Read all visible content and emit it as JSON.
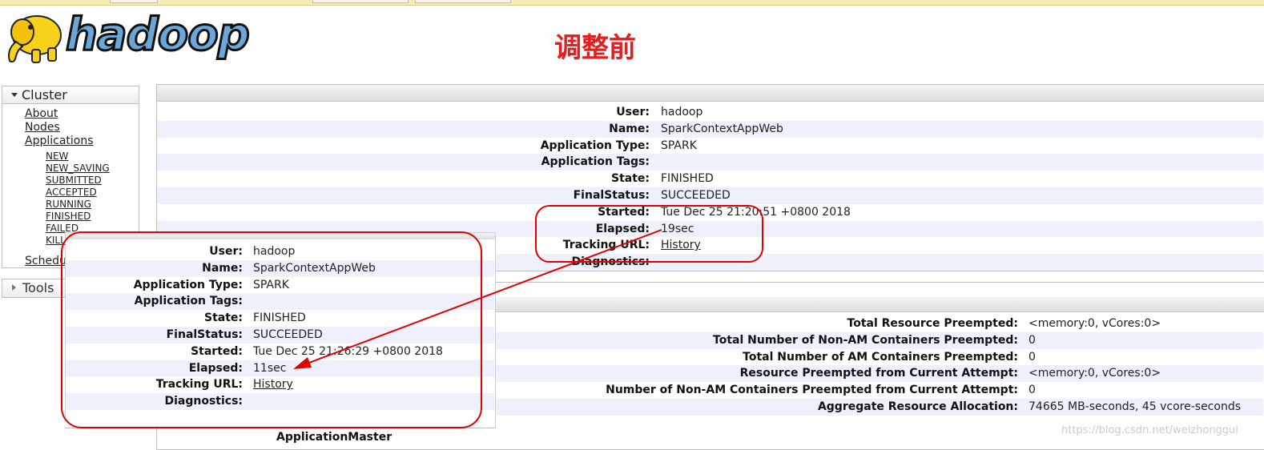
{
  "logo": {
    "text": "hadoop"
  },
  "annotation_title": "调整前",
  "sidebar": {
    "cluster_label": "Cluster",
    "links": [
      "About",
      "Nodes",
      "Applications"
    ],
    "app_states": [
      "NEW",
      "NEW_SAVING",
      "SUBMITTED",
      "ACCEPTED",
      "RUNNING",
      "FINISHED",
      "FAILED",
      "KILL"
    ],
    "scheduler_label": "Schedu",
    "tools_label": "Tools"
  },
  "overview": {
    "rows": [
      {
        "key": "User:",
        "value": "hadoop"
      },
      {
        "key": "Name:",
        "value": "SparkContextAppWeb"
      },
      {
        "key": "Application Type:",
        "value": "SPARK"
      },
      {
        "key": "Application Tags:",
        "value": ""
      },
      {
        "key": "State:",
        "value": "FINISHED"
      },
      {
        "key": "FinalStatus:",
        "value": "SUCCEEDED"
      },
      {
        "key": "Started:",
        "value": "Tue Dec 25 21:20:51 +0800 2018"
      },
      {
        "key": "Elapsed:",
        "value": "19sec"
      },
      {
        "key": "Tracking URL:",
        "value": "History"
      },
      {
        "key": "Diagnostics:",
        "value": ""
      }
    ]
  },
  "metrics": {
    "rows": [
      {
        "key": "Total Resource Preempted:",
        "value": "<memory:0, vCores:0>"
      },
      {
        "key": "Total Number of Non-AM Containers Preempted:",
        "value": "0"
      },
      {
        "key": "Total Number of AM Containers Preempted:",
        "value": "0"
      },
      {
        "key": "Resource Preempted from Current Attempt:",
        "value": "<memory:0, vCores:0>"
      },
      {
        "key": "Number of Non-AM Containers Preempted from Current Attempt:",
        "value": "0"
      },
      {
        "key": "Aggregate Resource Allocation:",
        "value": "74665 MB-seconds, 45 vcore-seconds"
      }
    ]
  },
  "zoom": {
    "rows": [
      {
        "key": "User:",
        "value": "hadoop"
      },
      {
        "key": "Name:",
        "value": "SparkContextAppWeb"
      },
      {
        "key": "Application Type:",
        "value": "SPARK"
      },
      {
        "key": "Application Tags:",
        "value": ""
      },
      {
        "key": "State:",
        "value": "FINISHED"
      },
      {
        "key": "FinalStatus:",
        "value": "SUCCEEDED"
      },
      {
        "key": "Started:",
        "value": "Tue Dec 25 21:26:29 +0800 2018"
      },
      {
        "key": "Elapsed:",
        "value": "11sec"
      },
      {
        "key": "Tracking URL:",
        "value": "History"
      },
      {
        "key": "Diagnostics:",
        "value": ""
      }
    ]
  },
  "application_master_label": "ApplicationMaster",
  "watermark": "https://blog.csdn.net/weizhonggui",
  "colors": {
    "annotation_red": "#e00000",
    "row_alt": "#eef0fb",
    "logo_blue": "#6aa6d8"
  }
}
